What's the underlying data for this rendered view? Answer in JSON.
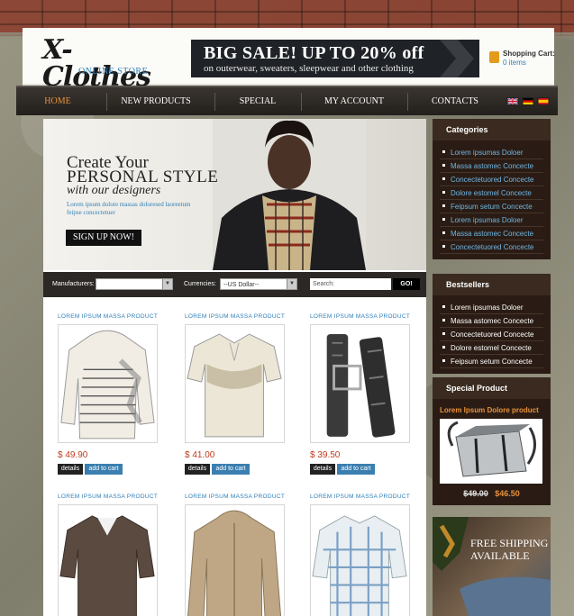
{
  "header": {
    "logo_title": "X-Clothes",
    "logo_subtitle": "ONLINE STORE",
    "banner_line1": "BIG SALE! UP TO 20% off",
    "banner_line2": "on outerwear, sweaters, sleepwear and other clothing",
    "cart_label": "Shopping Cart:",
    "cart_items": "0 items"
  },
  "nav": {
    "items": [
      {
        "label": "HOME"
      },
      {
        "label": "NEW PRODUCTS"
      },
      {
        "label": "SPECIAL"
      },
      {
        "label": "MY ACCOUNT"
      },
      {
        "label": "CONTACTS"
      }
    ],
    "flags": [
      "uk-flag-icon",
      "germany-flag-icon",
      "spain-flag-icon"
    ]
  },
  "hero": {
    "line1": "Create Your",
    "line2": "PERSONAL STYLE",
    "line3": "with our designers",
    "text": "Lorem ipsum dolore massas doloresed laoreetum feipse concectetuer",
    "button": "SIGN UP NOW!"
  },
  "filter": {
    "manufacturers_label": "Manufacturers:",
    "manufacturers_value": "",
    "currencies_label": "Currencies:",
    "currencies_value": "--US Dollar--",
    "search_placeholder": "Search:",
    "go_label": "GO!"
  },
  "products": [
    {
      "title": "LOREM IPSUM MASSA PRODUCT",
      "price": "$ 49.90",
      "image": "striped-hoodie",
      "details": "details",
      "add": "add to cart"
    },
    {
      "title": "LOREM IPSUM MASSA PRODUCT",
      "price": "$ 41.00",
      "image": "polo-shirt",
      "details": "details",
      "add": "add to cart"
    },
    {
      "title": "LOREM IPSUM MASSA PRODUCT",
      "price": "$ 39.50",
      "image": "leather-belt",
      "details": "details",
      "add": "add to cart"
    },
    {
      "title": "LOREM IPSUM MASSA PRODUCT",
      "price": "",
      "image": "brown-shirt",
      "details": "",
      "add": ""
    },
    {
      "title": "LOREM IPSUM MASSA PRODUCT",
      "price": "",
      "image": "beige-jacket",
      "details": "",
      "add": ""
    },
    {
      "title": "LOREM IPSUM MASSA PRODUCT",
      "price": "",
      "image": "plaid-shirt",
      "details": "",
      "add": ""
    }
  ],
  "sidebar": {
    "categories_title": "Categories",
    "categories": [
      "Lorem ipsumas Doloer",
      "Massa astomec Concecte",
      "Concectetuored Concecte",
      "Dolore estomel Concecte",
      "Feipsum setum Concecte",
      "Lorem ipsumas Doloer",
      "Massa astomec Concecte",
      "Concectetuored Concecte"
    ],
    "bestsellers_title": "Bestsellers",
    "bestsellers": [
      "Lorem ipsumas Doloer",
      "Massa astomec Concecte",
      "Concectetuored Concecte",
      "Dolore estomel Concecte",
      "Feipsum setum Concecte"
    ],
    "special_title": "Special Product",
    "special_name": "Lorem Ipsum Dolore product",
    "special_old_price": "$49.00",
    "special_new_price": "$46.50",
    "shipping_line1": "FREE SHIPPING",
    "shipping_line2": "AVAILABLE"
  },
  "colors": {
    "accent": "#e8913b",
    "link": "#2f7fb8",
    "price": "#c0391b",
    "sidebar": "#2a1c14"
  }
}
